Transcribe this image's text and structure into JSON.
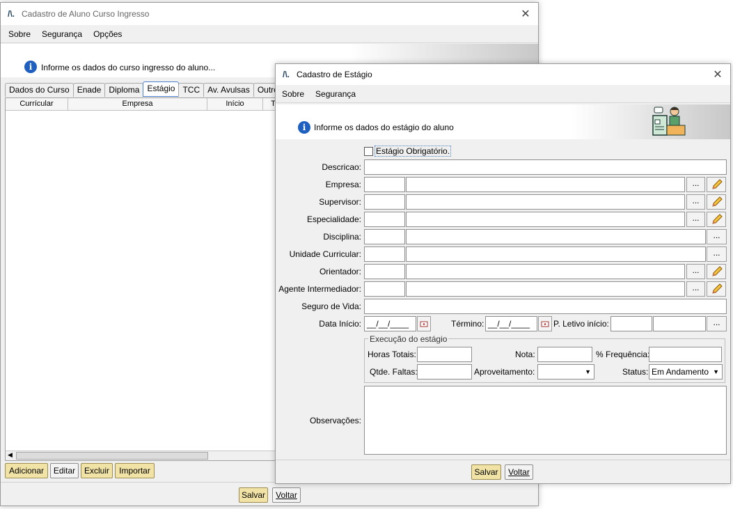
{
  "back_window": {
    "title": "Cadastro de Aluno Curso Ingresso",
    "menu": [
      "Sobre",
      "Segurança",
      "Opções"
    ],
    "info": "Informe os dados do curso ingresso do aluno...",
    "tabs": [
      "Dados do Curso",
      "Enade",
      "Diploma",
      "Estágio",
      "TCC",
      "Av. Avulsas",
      "Outro"
    ],
    "active_tab": "Estágio",
    "columns": [
      "Currícular",
      "Empresa",
      "Início",
      "T"
    ],
    "buttons": {
      "add": "Adicionar",
      "edit": "Editar",
      "delete": "Excluir",
      "import": "Importar",
      "save": "Salvar",
      "back": "Voltar"
    }
  },
  "front_window": {
    "title": "Cadastro de Estágio",
    "menu": [
      "Sobre",
      "Segurança"
    ],
    "info": "Informe os dados do estágio do aluno",
    "checkbox_label": "Estágio Obrigatório.",
    "labels": {
      "descricao": "Descricao:",
      "empresa": "Empresa:",
      "supervisor": "Supervisor:",
      "especialidade": "Especialidade:",
      "disciplina": "Disciplina:",
      "unidade": "Unidade Curricular:",
      "orientador": "Orientador:",
      "agente": "Agente Intermediador:",
      "seguro": "Seguro de Vida:",
      "data_inicio": "Data Início:",
      "termino": "Término:",
      "p_letivo": "P. Letivo início:",
      "observacoes": "Observações:"
    },
    "date_placeholder": "__/__/____",
    "lookup_button": "...",
    "execucao": {
      "legend": "Execução do estágio",
      "horas": "Horas Totais:",
      "nota": "Nota:",
      "frequencia": "% Frequência:",
      "faltas": "Qtde. Faltas:",
      "aproveitamento": "Aproveitamento:",
      "status_label": "Status:",
      "status_value": "Em Andamento"
    },
    "buttons": {
      "save": "Salvar",
      "back": "Voltar"
    }
  }
}
